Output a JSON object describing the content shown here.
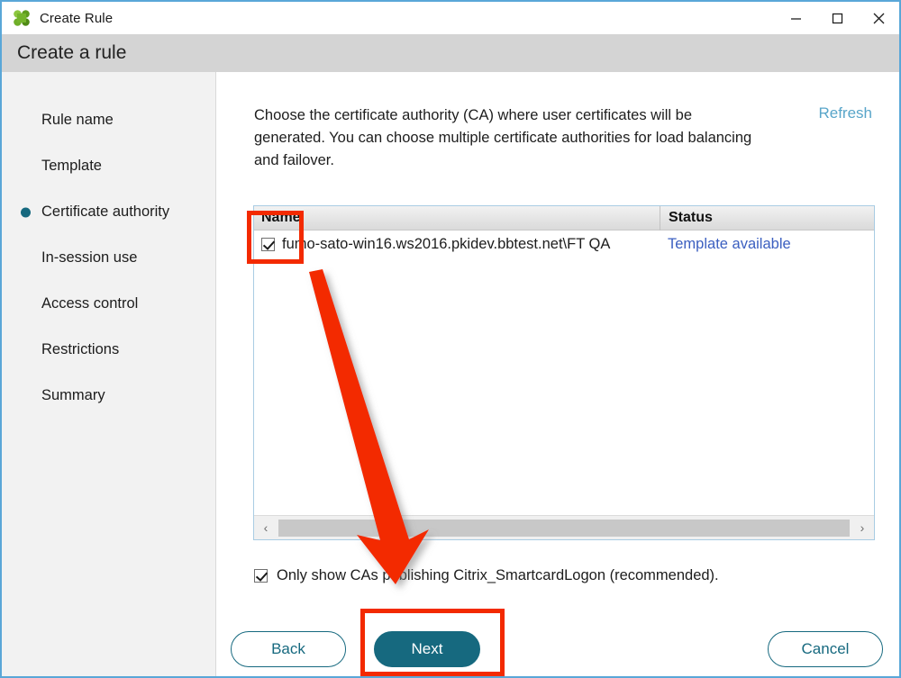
{
  "window": {
    "title": "Create Rule",
    "icon": "citrix-logo-icon",
    "controls": {
      "minimize": "–",
      "maximize": "☐",
      "close": "✕"
    }
  },
  "header": {
    "heading": "Create a rule"
  },
  "sidebar": {
    "items": [
      {
        "label": "Rule name",
        "active": false
      },
      {
        "label": "Template",
        "active": false
      },
      {
        "label": "Certificate authority",
        "active": true
      },
      {
        "label": "In-session use",
        "active": false
      },
      {
        "label": "Access control",
        "active": false
      },
      {
        "label": "Restrictions",
        "active": false
      },
      {
        "label": "Summary",
        "active": false
      }
    ]
  },
  "main": {
    "description": "Choose the certificate authority (CA) where user certificates will be generated. You can choose multiple certificate authorities for load balancing and failover.",
    "refresh_label": "Refresh",
    "table": {
      "columns": [
        "Name",
        "Status"
      ],
      "rows": [
        {
          "checked": true,
          "name": "fumo-sato-win16.ws2016.pkidev.bbtest.net\\FT QA",
          "status": "Template available"
        }
      ]
    },
    "scrollbar": {
      "left_arrow": "‹",
      "right_arrow": "›"
    },
    "only_show_option": {
      "checked": true,
      "label": "Only show CAs publishing Citrix_SmartcardLogon (recommended)."
    }
  },
  "footer": {
    "back_label": "Back",
    "next_label": "Next",
    "cancel_label": "Cancel"
  },
  "colors": {
    "accent_teal": "#16697f",
    "link_blue": "#58a5c9",
    "status_blue": "#3b5fc0",
    "annotation_red": "#f32a00",
    "header_band": "#d4d4d4",
    "sidebar_bg": "#f2f2f2",
    "window_border": "#5aa7d8"
  }
}
